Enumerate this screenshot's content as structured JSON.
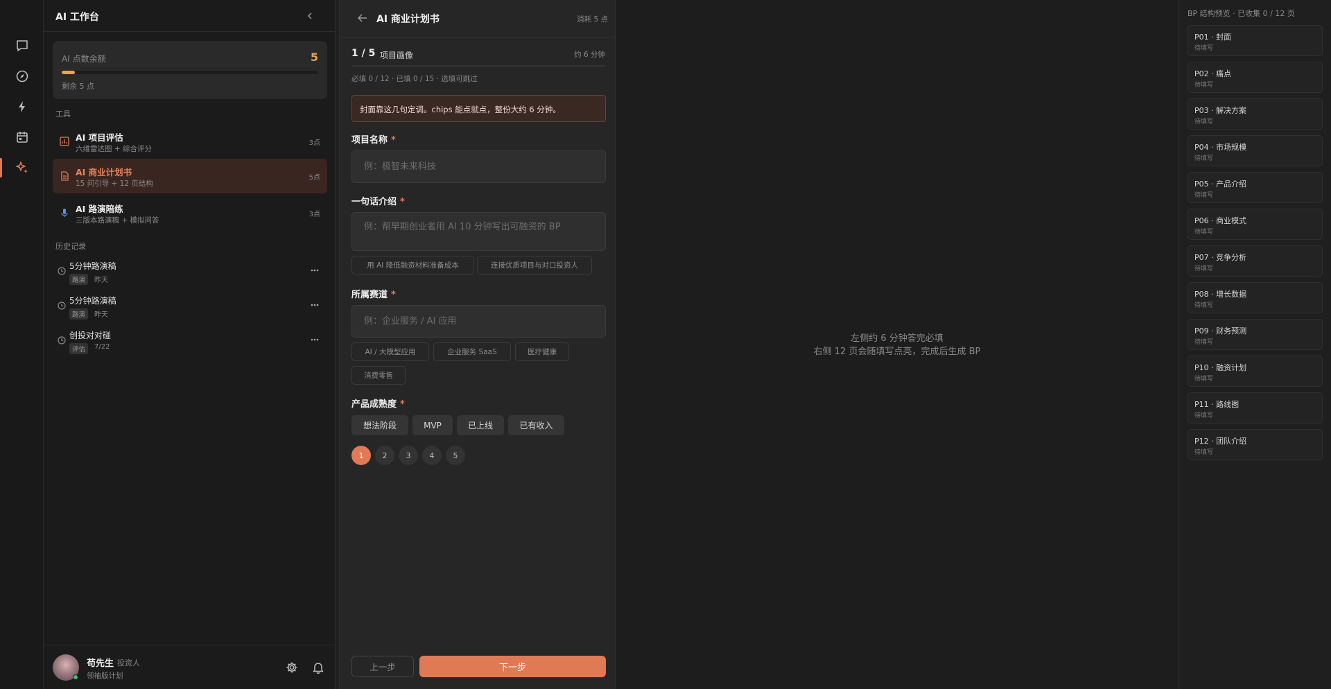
{
  "sidebar": {
    "title": "AI 工作台",
    "credits": {
      "label": "AI 点数余额",
      "value": "5",
      "remaining": "剩余 5 点",
      "fraction": 0.05
    },
    "tools_heading": "工具",
    "tools": [
      {
        "name": "AI 项目评估",
        "desc": "六维雷达图 + 综合评分",
        "cost": "3点",
        "icon": "chart-icon"
      },
      {
        "name": "AI 商业计划书",
        "desc": "15 问引导 + 12 页结构",
        "cost": "5点",
        "icon": "document-icon"
      },
      {
        "name": "AI 路演陪练",
        "desc": "三版本路演稿 + 模拟问答",
        "cost": "3点",
        "icon": "microphone-icon"
      }
    ],
    "history_heading": "历史记录",
    "history": [
      {
        "name": "5分钟路演稿",
        "tag": "路演",
        "time": "昨天"
      },
      {
        "name": "5分钟路演稿",
        "tag": "路演",
        "time": "昨天"
      },
      {
        "name": "创投对对碰",
        "tag": "评估",
        "time": "7/22"
      }
    ],
    "user": {
      "name": "苟先生",
      "role": "投资人",
      "plan": "领袖版计划"
    }
  },
  "form": {
    "title": "AI 商业计划书",
    "cost": "消耗 5 点",
    "step": "1 / 5",
    "step_name": "项目画像",
    "step_time": "约 6 分钟",
    "progress": "必填 0 / 12 · 已填 0 / 15 · 选填可跳过",
    "tip": "封面靠这几句定调。chips 能点就点，整份大约 6 分钟。",
    "fields": {
      "name": {
        "label": "项目名称",
        "required": "*",
        "placeholder": "例：极智未来科技",
        "value": ""
      },
      "intro": {
        "label": "一句话介绍",
        "required": "*",
        "placeholder": "例：帮早期创业者用 AI 10 分钟写出可融资的 BP",
        "value": "",
        "chips": [
          "用 AI 降低融资材料准备成本",
          "连接优质项目与对口投资人"
        ]
      },
      "track": {
        "label": "所属赛道",
        "required": "*",
        "placeholder": "例：企业服务 / AI 应用",
        "value": "",
        "chips": [
          "AI / 大模型应用",
          "企业服务 SaaS",
          "医疗健康",
          "消费零售"
        ]
      },
      "stage": {
        "label": "产品成熟度",
        "required": "*",
        "options": [
          "想法阶段",
          "MVP",
          "已上线",
          "已有收入"
        ]
      }
    },
    "pages": [
      "1",
      "2",
      "3",
      "4",
      "5"
    ],
    "current_page": "1",
    "prev_label": "上一步",
    "next_label": "下一步"
  },
  "preview": {
    "line1": "左侧约 6 分钟答完必填",
    "line2": "右侧 12 页会随填写点亮，完成后生成 BP"
  },
  "outline": {
    "heading": "BP 结构预览 · 已收集 0 / 12 页",
    "pages": [
      {
        "title": "P01 · 封面",
        "status": "待填写"
      },
      {
        "title": "P02 · 痛点",
        "status": "待填写"
      },
      {
        "title": "P03 · 解决方案",
        "status": "待填写"
      },
      {
        "title": "P04 · 市场规模",
        "status": "待填写"
      },
      {
        "title": "P05 · 产品介绍",
        "status": "待填写"
      },
      {
        "title": "P06 · 商业模式",
        "status": "待填写"
      },
      {
        "title": "P07 · 竞争分析",
        "status": "待填写"
      },
      {
        "title": "P08 · 增长数据",
        "status": "待填写"
      },
      {
        "title": "P09 · 财务预测",
        "status": "待填写"
      },
      {
        "title": "P10 · 融资计划",
        "status": "待填写"
      },
      {
        "title": "P11 · 路线图",
        "status": "待填写"
      },
      {
        "title": "P12 · 团队介绍",
        "status": "待填写"
      }
    ]
  },
  "colors": {
    "accent": "#e07a55",
    "credit": "#e8a552",
    "background": "#1f1f1f"
  }
}
